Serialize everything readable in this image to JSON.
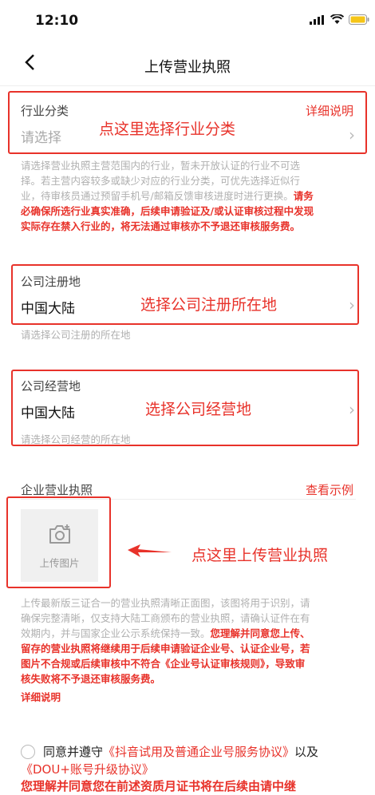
{
  "status": {
    "time": "12:10"
  },
  "nav": {
    "title": "上传营业执照"
  },
  "industry": {
    "label": "行业分类",
    "link": "详细说明",
    "placeholder": "请选择",
    "annotation": "点这里选择行业分类",
    "hint_lines": [
      "请选择营业执照主营范围内的行业，暂未开放认证的行业不可选",
      "择。若主营内容较多或缺少对应的行业分类，可优先选择近似行",
      "业，待审核员通过预留手机号/邮箱反馈审核进度时进行更换。"
    ],
    "hint_red_tail": "请务",
    "warning_lines": [
      "必确保所选行业真实准确，后续申请验证及/或认证审核过程中发现",
      "实际存在禁入行业的，将无法通过审核亦不予退还审核服务费。"
    ]
  },
  "register": {
    "label": "公司注册地",
    "value": "中国大陆",
    "annotation": "选择公司注册所在地",
    "hint": "请选择公司注册的所在地"
  },
  "operate": {
    "label": "公司经营地",
    "value": "中国大陆",
    "annotation": "选择公司经营地",
    "hint": "请选择公司经营的所在地"
  },
  "license": {
    "label": "企业营业执照",
    "link": "查看示例",
    "upload_label": "上传图片",
    "annotation": "点这里上传营业执照",
    "desc_lines": [
      "上传最新版三证合一的营业执照清晰正面图，该图将用于识别，请",
      "确保完整清晰，仅支持大陆工商颁布的营业执照，请确认证件在有",
      "效期内，并与国家企业公示系统保持一致。"
    ],
    "desc_red_tail": "您理解并同意您上传、",
    "warn_line1": "留存的营业执照将继续用于后续申请验证企业号、认证企业号，若",
    "warn_line2_a": "图片不合规或后续审核中不符合",
    "warn_line2_b": "《企业号认证审核规则》",
    "warn_line2_c": "，导致审",
    "warn_line3": "核失败将不予退还审核服务费。",
    "detail_link": "详细说明"
  },
  "agreement": {
    "prefix": "同意并遵守",
    "link1": "《抖音试用及普通企业号服务协议》",
    "mid": "以及",
    "link2": "《DOU+账号升级协议》",
    "cut_line": "您理解并同意您在前述资质月证书将在后续由请中继"
  }
}
